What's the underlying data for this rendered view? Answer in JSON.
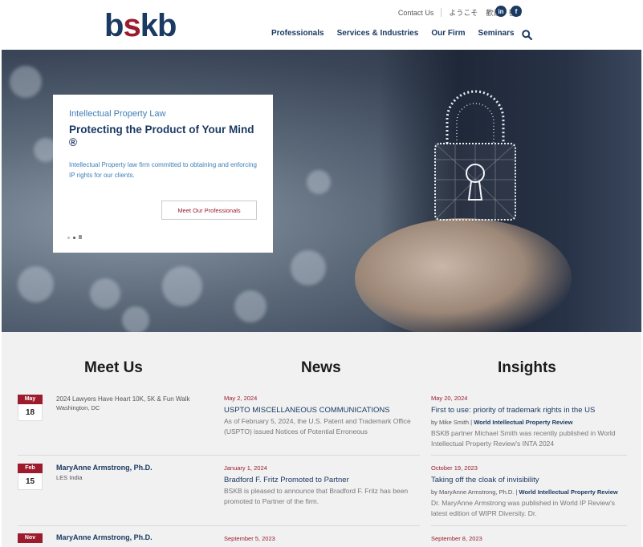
{
  "header": {
    "logo_text": "bskb",
    "utility_nav": [
      "Contact Us",
      "ようこそ",
      "歡迎",
      "환영"
    ],
    "social": [
      "in",
      "f"
    ],
    "main_nav": [
      "Professionals",
      "Services & Industries",
      "Our Firm",
      "Seminars"
    ]
  },
  "hero": {
    "kicker": "Intellectual Property Law",
    "headline": "Protecting the Product of Your Mind ®",
    "description": "Intellectual Property law firm committed to obtaining and enforcing IP rights for our clients.",
    "button_label": "Meet Our Professionals",
    "pause_symbol": "II"
  },
  "meet_us": {
    "title": "Meet Us",
    "items": [
      {
        "month": "May",
        "day": "18",
        "title": "2024 Lawyers Have Heart 10K, 5K & Fun Walk",
        "location": "Washington, DC"
      },
      {
        "month": "Feb",
        "day": "15",
        "title": "MaryAnne Armstrong, Ph.D.",
        "location": "LES India"
      },
      {
        "month": "Nov",
        "day": "",
        "title": "MaryAnne Armstrong, Ph.D.",
        "location": ""
      }
    ]
  },
  "news": {
    "title": "News",
    "items": [
      {
        "date": "May 2, 2024",
        "title": "USPTO MISCELLANEOUS COMMUNICATIONS",
        "text": "As of February 5, 2024, the U.S. Patent and Trademark Office (USPTO) issued Notices of Potential Erroneous"
      },
      {
        "date": "January 1, 2024",
        "title": "Bradford F. Fritz Promoted to Partner",
        "text": "BSKB is pleased to announce that Bradford F. Fritz has been promoted to Partner of the firm."
      },
      {
        "date": "September 5, 2023",
        "title": "",
        "text": ""
      }
    ]
  },
  "insights": {
    "title": "Insights",
    "items": [
      {
        "date": "May 20, 2024",
        "title": "First to use: priority of trademark rights in the US",
        "by": "by Mike Smith |",
        "source": "World Intellectual Property Review",
        "text": "BSKB partner Michael Smith was recently published in World Intellectual Property Review's INTA 2024"
      },
      {
        "date": "October 19, 2023",
        "title": "Taking off the cloak of invisibility",
        "by": "by MaryAnne Armstrong, Ph.D. |",
        "source": "World Intellectual Property Review",
        "text": "Dr. MaryAnne Armstrong was published in World IP Review's latest edition of WIPR Diversity. Dr."
      },
      {
        "date": "September 8, 2023",
        "title": "",
        "by": "",
        "source": "",
        "text": ""
      }
    ]
  }
}
